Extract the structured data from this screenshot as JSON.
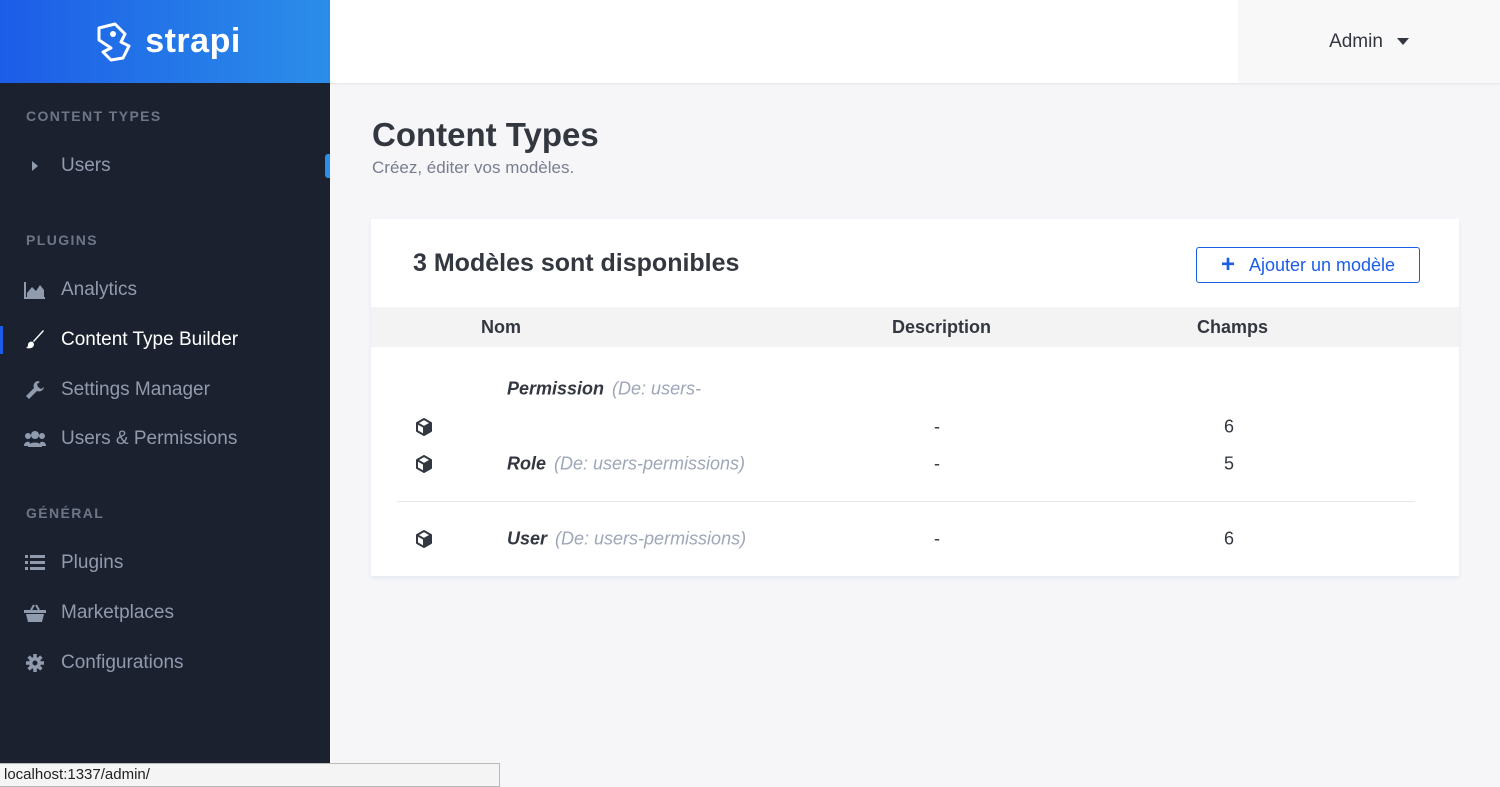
{
  "brand": {
    "name": "strapi"
  },
  "header": {
    "user": "Admin"
  },
  "sidebar": {
    "sections": [
      {
        "title": "Content Types",
        "items": [
          {
            "label": "Users",
            "icon": "caret-right-icon"
          }
        ]
      },
      {
        "title": "Plugins",
        "items": [
          {
            "label": "Analytics",
            "icon": "area-chart-icon"
          },
          {
            "label": "Content Type Builder",
            "icon": "paint-brush-icon"
          },
          {
            "label": "Settings Manager",
            "icon": "wrench-icon"
          },
          {
            "label": "Users & Permissions",
            "icon": "users-icon"
          }
        ]
      },
      {
        "title": "Général",
        "items": [
          {
            "label": "Plugins",
            "icon": "list-icon"
          },
          {
            "label": "Marketplaces",
            "icon": "basket-icon"
          },
          {
            "label": "Configurations",
            "icon": "gear-icon"
          }
        ]
      }
    ]
  },
  "main": {
    "title": "Content Types",
    "subtitle": "Créez, éditer vos modèles.",
    "card": {
      "title": "3 Modèles sont disponibles",
      "add_button": "Ajouter un modèle",
      "columns": [
        "Nom",
        "Description",
        "Champs"
      ],
      "rows": [
        {
          "name": "Permission",
          "from": "(De: users-",
          "description": "-",
          "fields": "6"
        },
        {
          "name": "Role",
          "from": "(De: users-permissions)",
          "description": "-",
          "fields": "5"
        },
        {
          "name": "User",
          "from": "(De: users-permissions)",
          "description": "-",
          "fields": "6"
        }
      ]
    }
  },
  "statusbar": {
    "url": "localhost:1337/admin/"
  },
  "colors": {
    "accent": "#1c5de7",
    "sidebar": "#1b212e",
    "brand_start": "#1c5de7",
    "brand_end": "#2b8ee9"
  }
}
